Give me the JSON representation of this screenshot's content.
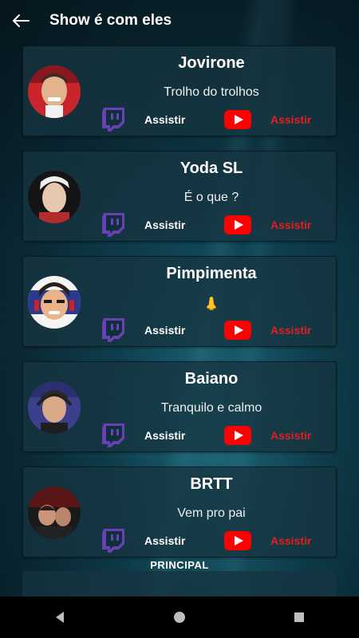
{
  "header": {
    "title": "Show é com eles",
    "back_icon": "arrow-left-icon"
  },
  "colors": {
    "twitch": "#6441a5",
    "youtube_red": "#ff0000",
    "watch_red": "#e02020"
  },
  "streamers": [
    {
      "name": "Jovirone",
      "status": "Trolho do trolhos",
      "twitch_label": "Assistir",
      "youtube_label": "Assistir"
    },
    {
      "name": "Yoda SL",
      "status": "É o que ?",
      "twitch_label": "Assistir",
      "youtube_label": "Assistir"
    },
    {
      "name": "Pimpimenta",
      "status": "👃",
      "twitch_label": "Assistir",
      "youtube_label": "Assistir"
    },
    {
      "name": "Baiano",
      "status": "Tranquilo e calmo",
      "twitch_label": "Assistir",
      "youtube_label": "Assistir"
    },
    {
      "name": "BRTT",
      "status": "Vem pro pai",
      "twitch_label": "Assistir",
      "youtube_label": "Assistir"
    }
  ],
  "bottom_tab": {
    "label": "PRINCIPAL"
  },
  "navbar": {
    "icons": [
      "back-triangle-icon",
      "home-circle-icon",
      "recents-square-icon"
    ]
  }
}
